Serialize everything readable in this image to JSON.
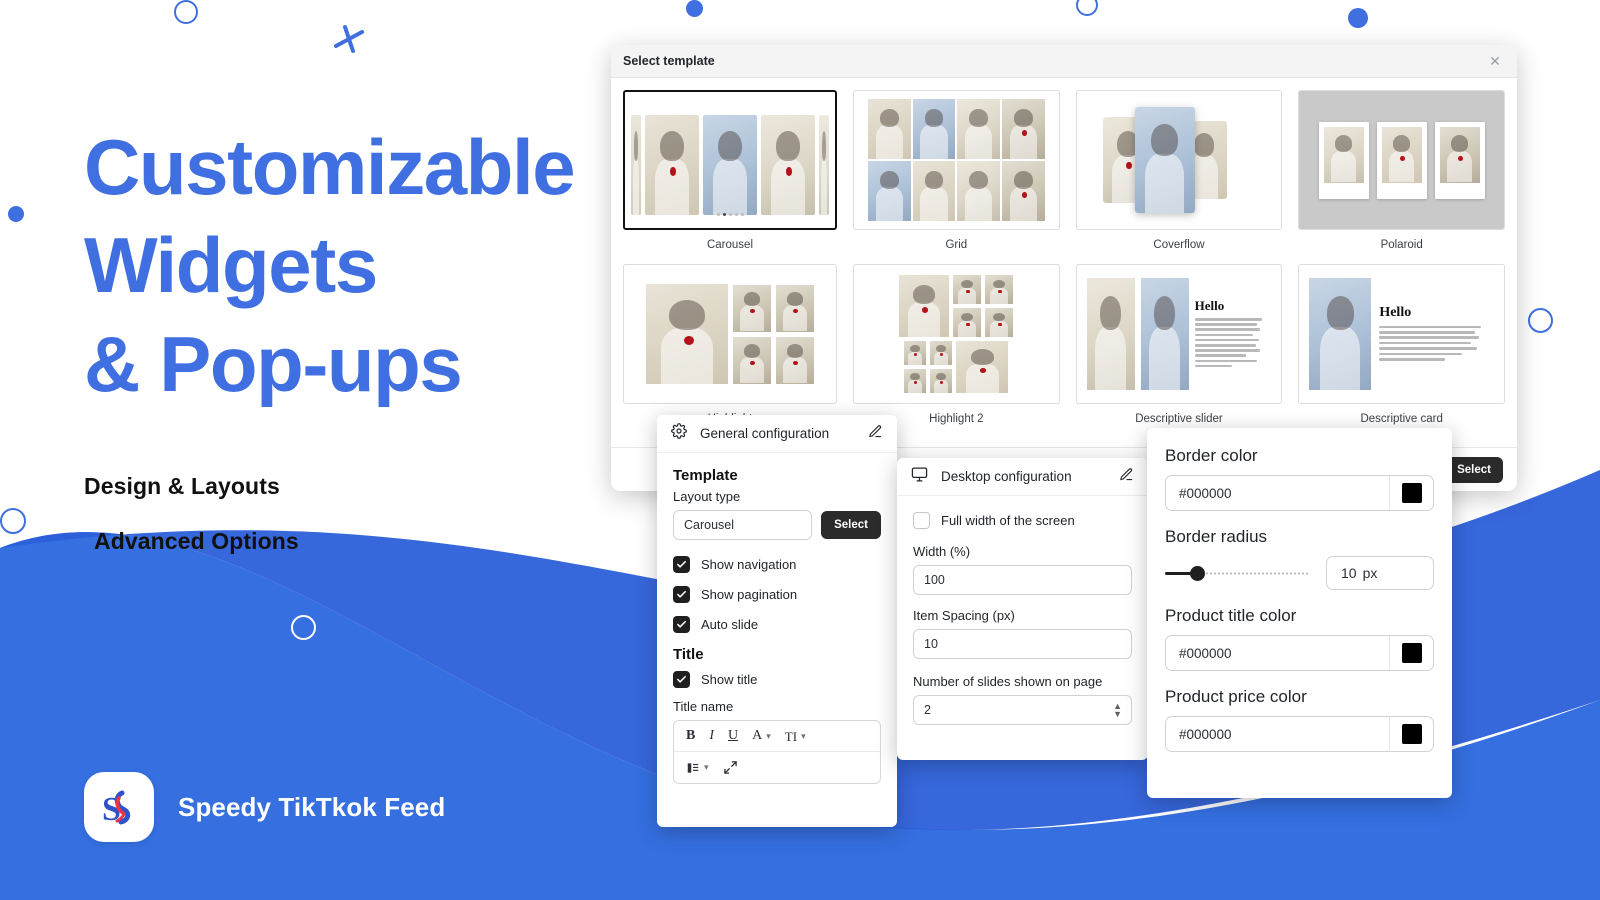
{
  "hero": {
    "line1": "Customizable",
    "line2": "Widgets",
    "line3": "& Pop-ups",
    "sub1": "Design & Layouts",
    "sub2": "Advanced Options"
  },
  "brand": {
    "name": "Speedy TikTkok Feed",
    "logo_letter": "S"
  },
  "colors": {
    "accent_blue": "#3f6fe0",
    "wave_light": "#356fe0",
    "wave_dark": "#2b5fd9",
    "dark_button": "#2b2b2b"
  },
  "modal": {
    "title": "Select template",
    "close_icon": "close-icon",
    "select_label": "Select",
    "templates": [
      {
        "label": "Carousel",
        "selected": true,
        "thumb": "carousel"
      },
      {
        "label": "Grid",
        "selected": false,
        "thumb": "grid"
      },
      {
        "label": "Coverflow",
        "selected": false,
        "thumb": "coverflow"
      },
      {
        "label": "Polaroid",
        "selected": false,
        "thumb": "polaroid"
      },
      {
        "label": "Highlight",
        "selected": false,
        "thumb": "highlight"
      },
      {
        "label": "Highlight 2",
        "selected": false,
        "thumb": "highlight2"
      },
      {
        "label": "Descriptive slider",
        "selected": false,
        "thumb": "descriptive-slider"
      },
      {
        "label": "Descriptive card",
        "selected": false,
        "thumb": "descriptive-card"
      }
    ],
    "card_heading": "Hello",
    "card_body": "Lorem Ipsum is simply dummy text of the printing and typesetting industry. Lorem Ipsum has been the industry's standard dummy text ever since the 1500s, when an unknown printer took a galley of type and scrambled it to make a type specimen book."
  },
  "general_panel": {
    "header": "General configuration",
    "header_icon": "gear-icon",
    "edit_icon": "pencil-icon",
    "group_template": "Template",
    "layout_type_label": "Layout type",
    "layout_type_value": "Carousel",
    "select_label": "Select",
    "checkboxes": [
      {
        "label": "Show navigation",
        "checked": true
      },
      {
        "label": "Show pagination",
        "checked": true
      },
      {
        "label": "Auto slide",
        "checked": true
      }
    ],
    "group_title": "Title",
    "show_title": {
      "label": "Show title",
      "checked": true
    },
    "title_name_label": "Title name",
    "toolbar": {
      "bold": "B",
      "italic": "I",
      "underline": "U",
      "font_color": "A",
      "text_size": "TI",
      "align_icon": "align-list-icon",
      "fullscreen_icon": "fullscreen-icon"
    }
  },
  "desktop_panel": {
    "header": "Desktop configuration",
    "header_icon": "desktop-icon",
    "edit_icon": "pencil-icon",
    "full_width": {
      "label": "Full width of the screen",
      "checked": false
    },
    "fields": [
      {
        "label": "Width (%)",
        "value": "100",
        "type": "text"
      },
      {
        "label": "Item Spacing (px)",
        "value": "10",
        "type": "text"
      },
      {
        "label": "Number of slides shown on page",
        "value": "2",
        "type": "stepper"
      }
    ]
  },
  "style_panel": {
    "border_color": {
      "label": "Border color",
      "value": "#000000",
      "swatch": "#000000"
    },
    "border_radius": {
      "label": "Border radius",
      "value": "10",
      "unit": "px",
      "percent": 22
    },
    "product_title_color": {
      "label": "Product title color",
      "value": "#000000",
      "swatch": "#000000"
    },
    "product_price_color": {
      "label": "Product price color",
      "value": "#000000",
      "swatch": "#000000"
    }
  }
}
